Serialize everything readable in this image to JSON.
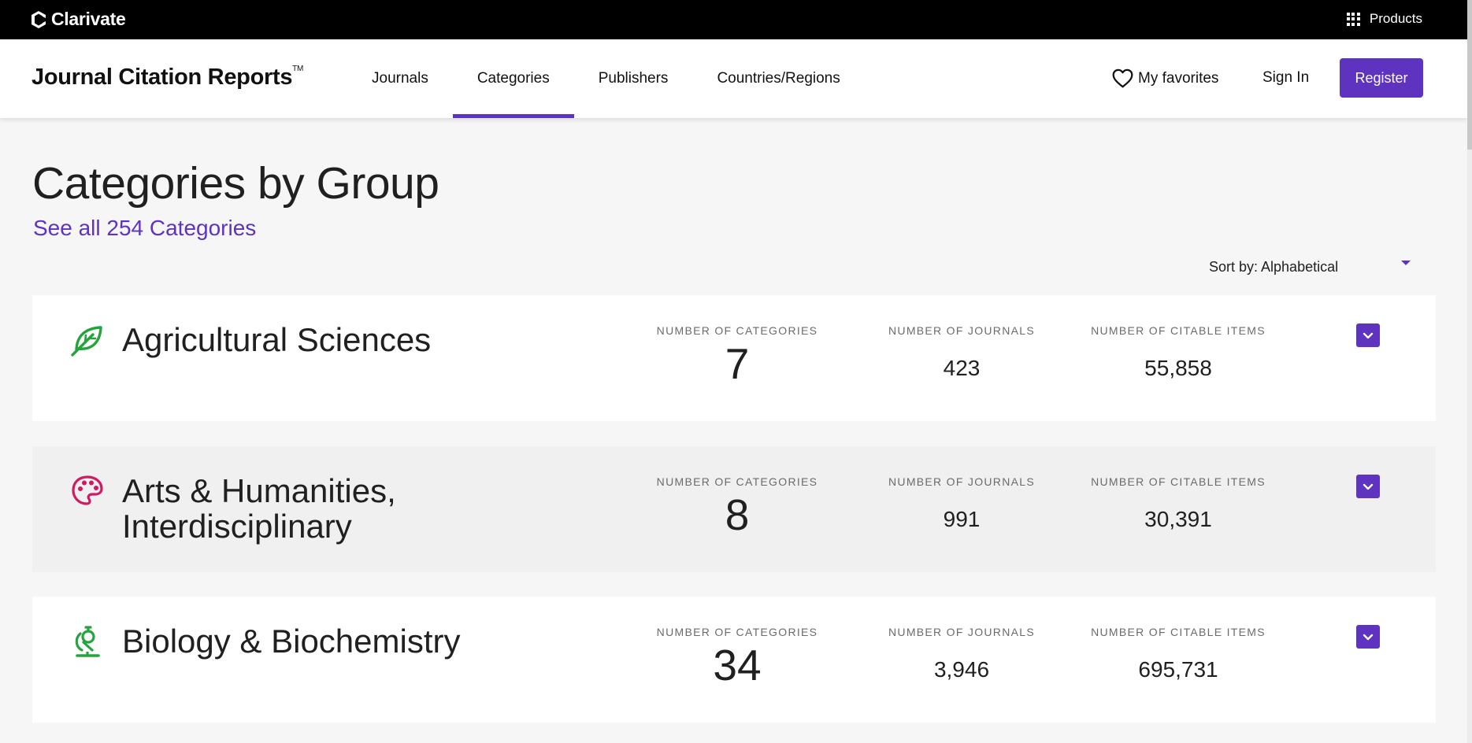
{
  "topbar": {
    "brand": "Clarivate",
    "products_label": "Products"
  },
  "header": {
    "title": "Journal Citation Reports",
    "trademark": "TM",
    "nav": [
      "Journals",
      "Categories",
      "Publishers",
      "Countries/Regions"
    ],
    "active_nav": "Categories",
    "favorites_label": "My favorites",
    "signin_label": "Sign In",
    "register_label": "Register"
  },
  "page": {
    "title": "Categories by Group",
    "see_all_link": "See all 254 Categories",
    "sort_label": "Sort by: Alphabetical"
  },
  "stat_labels": {
    "categories": "NUMBER OF CATEGORIES",
    "journals": "NUMBER OF JOURNALS",
    "citable": "NUMBER OF CITABLE ITEMS"
  },
  "groups": [
    {
      "name": "Agricultural Sciences",
      "icon": "leaf-icon",
      "icon_color": "#23a53c",
      "categories": "7",
      "journals": "423",
      "citable_items": "55,858"
    },
    {
      "name": "Arts & Humanities, Interdisciplinary",
      "icon": "palette-icon",
      "icon_color": "#d11a62",
      "categories": "8",
      "journals": "991",
      "citable_items": "30,391"
    },
    {
      "name": "Biology & Biochemistry",
      "icon": "microscope-icon",
      "icon_color": "#23a53c",
      "categories": "34",
      "journals": "3,946",
      "citable_items": "695,731"
    }
  ],
  "colors": {
    "accent": "#5e33bf",
    "topbar": "#000000",
    "background": "#f6f6f6"
  }
}
